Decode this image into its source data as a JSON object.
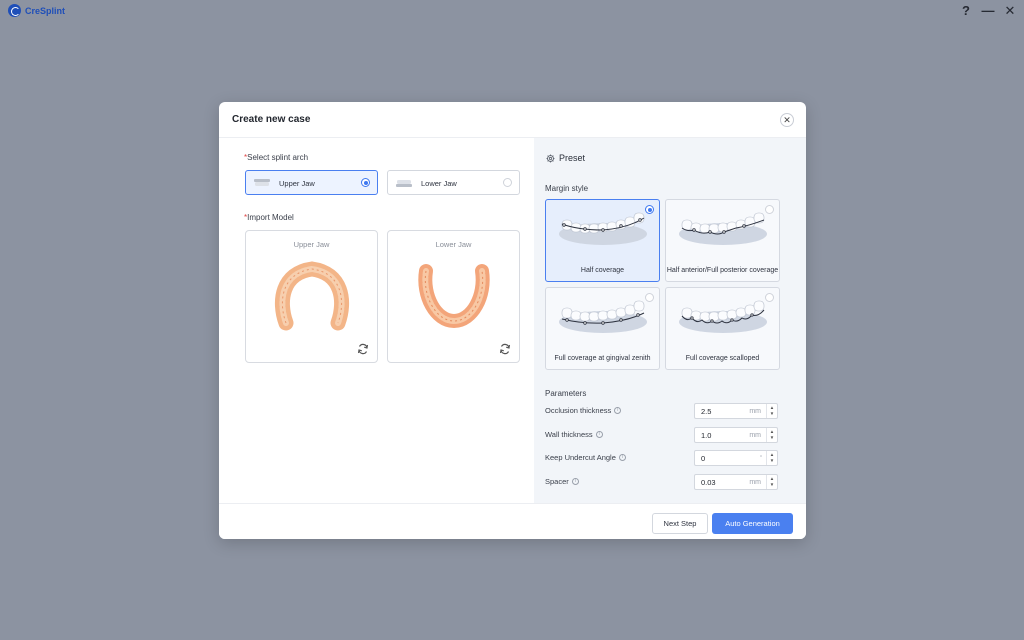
{
  "app": {
    "name": "CreSplint",
    "window_controls": {
      "help": "?",
      "minimize": "—",
      "close": "✕"
    }
  },
  "dialog": {
    "title": "Create new case",
    "close_icon": "close-icon",
    "splint_arch": {
      "required_mark": "*",
      "label": "Select splint arch",
      "options": [
        {
          "label": "Upper Jaw",
          "selected": true
        },
        {
          "label": "Lower Jaw",
          "selected": false
        }
      ]
    },
    "import_model": {
      "required_mark": "*",
      "label": "Import Model",
      "cards": [
        {
          "title": "Upper Jaw",
          "icon": "refresh-icon"
        },
        {
          "title": "Lower Jaw",
          "icon": "refresh-icon"
        }
      ]
    },
    "preset": {
      "label": "Preset",
      "icon": "gear-icon",
      "margin_style_label": "Margin style",
      "margin_styles": [
        {
          "label": "Half coverage",
          "selected": true
        },
        {
          "label": "Half anterior/Full posterior coverage",
          "selected": false
        },
        {
          "label": "Full coverage at gingival zenith",
          "selected": false
        },
        {
          "label": "Full coverage scalloped",
          "selected": false
        }
      ]
    },
    "parameters": {
      "label": "Parameters",
      "items": [
        {
          "name": "Occlusion thickness",
          "value": "2.5",
          "unit": "mm",
          "type": "number"
        },
        {
          "name": "Wall thickness",
          "value": "1.0",
          "unit": "mm",
          "type": "number"
        },
        {
          "name": "Keep Undercut Angle",
          "value": "0",
          "unit": "°",
          "type": "dropdown"
        },
        {
          "name": "Spacer",
          "value": "0.03",
          "unit": "mm",
          "type": "number"
        }
      ]
    },
    "footer": {
      "next_step": "Next Step",
      "auto_generation": "Auto Generation"
    }
  },
  "colors": {
    "accent": "#4a80f0",
    "background": "#8c93a1",
    "brand": "#1f4fb8",
    "model_orange": "#f0a070"
  }
}
